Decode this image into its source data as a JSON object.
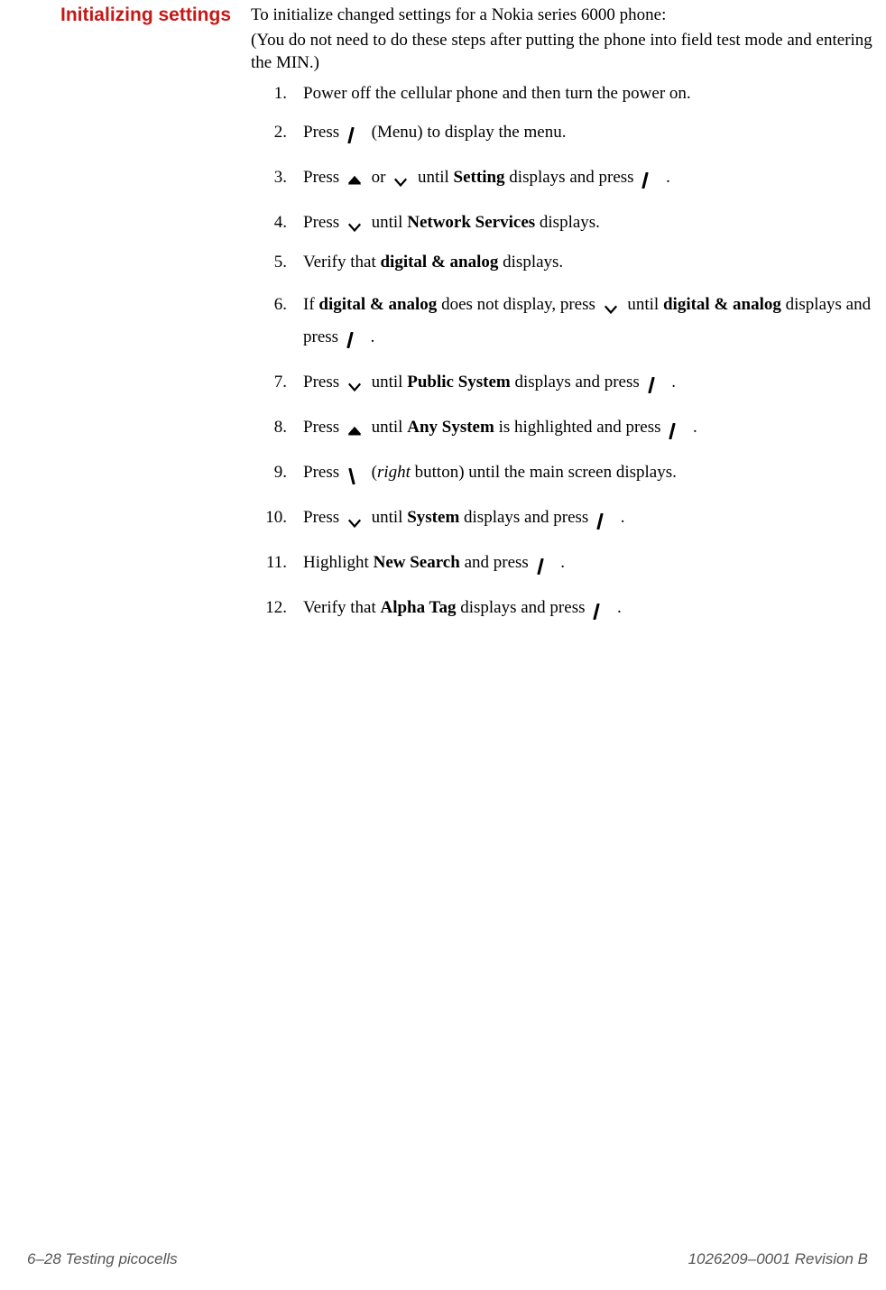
{
  "heading": "Initializing settings",
  "intro": "To initialize changed settings for a Nokia series 6000 phone:",
  "note": "(You do not need to do these steps after putting the phone into field test mode and entering the MIN.)",
  "steps": {
    "s1": "Power off the cellular phone and then turn the power on.",
    "s2_a": "Press ",
    "s2_b": " (Menu) to display the menu.",
    "s3_a": "Press ",
    "s3_b": " or ",
    "s3_c": " until ",
    "s3_bold": "Setting",
    "s3_d": " displays and press ",
    "s3_e": " .",
    "s4_a": "Press ",
    "s4_b": " until ",
    "s4_bold": "Network Services",
    "s4_c": " displays.",
    "s5_a": "Verify that ",
    "s5_bold": "digital & analog",
    "s5_b": " displays.",
    "s6_a": "If ",
    "s6_bold1": "digital & analog",
    "s6_b": " does not display, press ",
    "s6_c": " until ",
    "s6_bold2": "digital & analog",
    "s6_d": " displays and press ",
    "s6_e": " .",
    "s7_a": "Press ",
    "s7_b": " until ",
    "s7_bold": "Public System",
    "s7_c": " displays and press ",
    "s7_d": " .",
    "s8_a": "Press ",
    "s8_b": " until ",
    "s8_bold": "Any System",
    "s8_c": " is highlighted and press ",
    "s8_d": " .",
    "s9_a": "Press ",
    "s9_b": " (",
    "s9_italic": "right",
    "s9_c": " button) until the main screen displays.",
    "s10_a": "Press ",
    "s10_b": " until ",
    "s10_bold": "System",
    "s10_c": " displays and press ",
    "s10_d": " .",
    "s11_a": "Highlight ",
    "s11_bold": "New Search",
    "s11_b": " and press ",
    "s11_c": " .",
    "s12_a": "Verify that ",
    "s12_bold": "Alpha Tag",
    "s12_b": " displays and press ",
    "s12_c": " ."
  },
  "footer": {
    "left": "6–28  Testing picocells",
    "right": "1026209–0001  Revision B"
  }
}
